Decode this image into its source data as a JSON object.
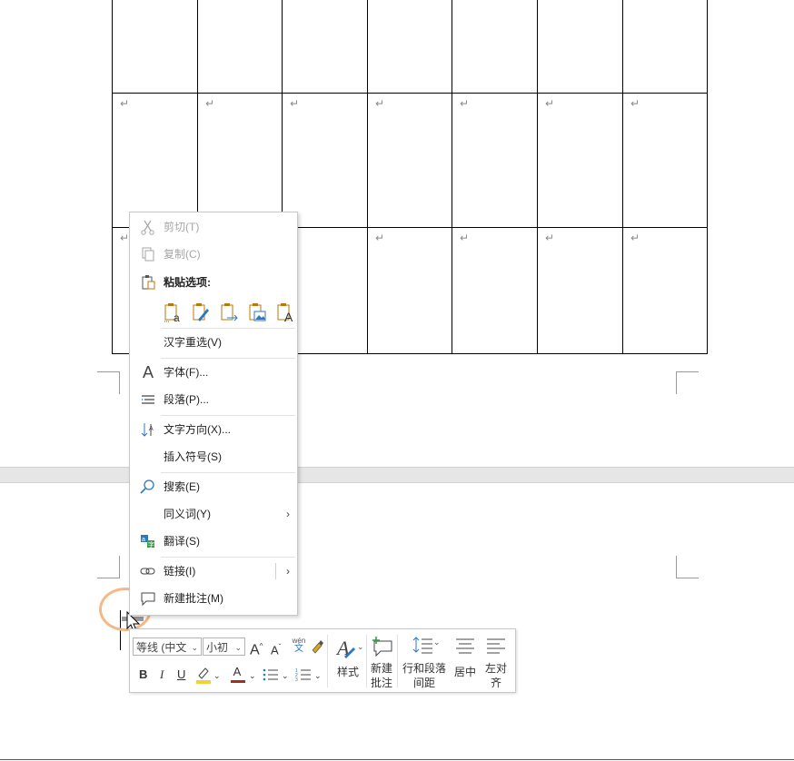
{
  "document": {
    "paragraph_mark": "↵",
    "page_break_marker": "↵"
  },
  "context_menu": {
    "cut": {
      "label": "剪切(T)",
      "enabled": false
    },
    "copy": {
      "label": "复制(C)",
      "enabled": false
    },
    "paste_options_label": "粘贴选项:",
    "paste_options": [
      {
        "icon": "paste-keep-source-icon",
        "glyph": "a"
      },
      {
        "icon": "paste-merge-format-icon",
        "glyph": "✎"
      },
      {
        "icon": "paste-link-icon",
        "glyph": "→"
      },
      {
        "icon": "paste-picture-icon",
        "glyph": "▣"
      },
      {
        "icon": "paste-text-only-icon",
        "glyph": "A"
      }
    ],
    "hanzi_reselect": "汉字重选(V)",
    "font": "字体(F)...",
    "paragraph": "段落(P)...",
    "text_direction": "文字方向(X)...",
    "insert_symbol": "插入符号(S)",
    "search": "搜索(E)",
    "synonyms": "同义词(Y)",
    "translate": "翻译(S)",
    "link": "链接(I)",
    "new_comment": "新建批注(M)"
  },
  "mini_toolbar": {
    "font_family": "等线 (中文",
    "font_size": "小初",
    "grow_font": "A",
    "shrink_font": "A",
    "phonetic_top": "wén",
    "phonetic_bottom": "文",
    "bold": "B",
    "italic": "I",
    "underline": "U",
    "font_color": "A",
    "styles": "样式",
    "new_comment_line1": "新建",
    "new_comment_line2": "批注",
    "line_spacing_line1": "行和段落",
    "line_spacing_line2": "间距",
    "center": "居中",
    "align_left_line1": "左对",
    "align_left_line2": "齐"
  },
  "colors": {
    "highlight": "#f2d23c",
    "font_color": "#a3301f",
    "accent_icon": "#2b78c2",
    "paste_icon": "#b9770e",
    "cursor_ring": "#f5b887"
  }
}
